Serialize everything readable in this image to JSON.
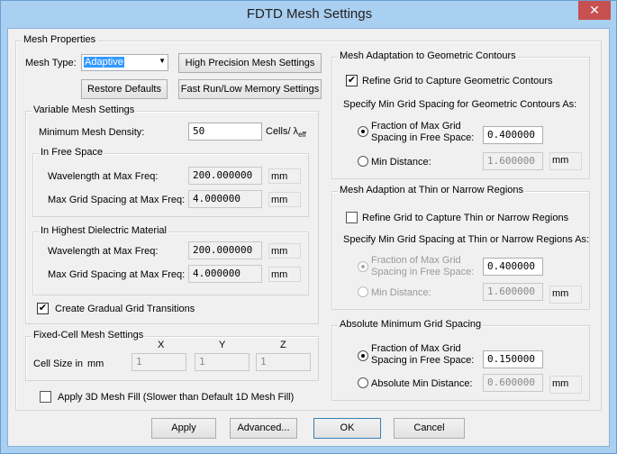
{
  "title": "FDTD Mesh Settings",
  "close": "✕",
  "mesh_properties": {
    "label": "Mesh Properties",
    "mesh_type_label": "Mesh Type:",
    "mesh_type_value": "Adaptive",
    "high_precision": "High Precision Mesh Settings",
    "restore_defaults": "Restore Defaults",
    "fast_run": "Fast Run/Low Memory Settings"
  },
  "variable": {
    "label": "Variable Mesh Settings",
    "min_density_label": "Minimum Mesh Density:",
    "min_density_value": "50",
    "min_density_unit": "Cells/ λ",
    "min_density_sub": "eff",
    "free_space": {
      "label": "In Free Space",
      "wavelength_label": "Wavelength at Max Freq:",
      "wavelength_value": "200.000000",
      "wavelength_unit": "mm",
      "spacing_label": "Max Grid Spacing at Max Freq:",
      "spacing_value": "4.000000",
      "spacing_unit": "mm"
    },
    "dielectric": {
      "label": "In Highest Dielectric Material",
      "wavelength_label": "Wavelength at Max Freq:",
      "wavelength_value": "200.000000",
      "wavelength_unit": "mm",
      "spacing_label": "Max Grid Spacing at Max Freq:",
      "spacing_value": "4.000000",
      "spacing_unit": "mm"
    },
    "gradual_label": "Create Gradual Grid Transitions",
    "gradual_checked": true
  },
  "fixed": {
    "label": "Fixed-Cell Mesh Settings",
    "x": "X",
    "y": "Y",
    "z": "Z",
    "cell_size_label": "Cell Size in",
    "unit": "mm",
    "x_value": "1",
    "y_value": "1",
    "z_value": "1"
  },
  "apply3d": {
    "label": "Apply 3D Mesh Fill (Slower than Default 1D Mesh Fill)",
    "checked": false
  },
  "contours": {
    "label": "Mesh Adaptation to Geometric Contours",
    "refine_label": "Refine Grid to Capture Geometric Contours",
    "refine_checked": true,
    "specify": "Specify Min Grid Spacing for Geometric Contours As:",
    "fraction_label1": "Fraction of Max Grid",
    "fraction_label2": "Spacing in Free Space:",
    "fraction_value": "0.400000",
    "min_label": "Min Distance:",
    "min_value": "1.600000",
    "unit": "mm"
  },
  "thin": {
    "label": "Mesh Adaption at Thin or Narrow Regions",
    "refine_label": "Refine Grid to Capture Thin or Narrow Regions",
    "refine_checked": false,
    "specify": "Specify Min Grid Spacing at Thin or Narrow Regions As:",
    "fraction_label1": "Fraction of Max Grid",
    "fraction_label2": "Spacing in Free Space:",
    "fraction_value": "0.400000",
    "min_label": "Min Distance:",
    "min_value": "1.600000",
    "unit": "mm"
  },
  "absolute": {
    "label": "Absolute Minimum Grid Spacing",
    "fraction_label1": "Fraction of Max Grid",
    "fraction_label2": "Spacing in Free Space:",
    "fraction_value": "0.150000",
    "min_label": "Absolute Min Distance:",
    "min_value": "0.600000",
    "unit": "mm"
  },
  "buttons": {
    "apply": "Apply",
    "advanced": "Advanced...",
    "ok": "OK",
    "cancel": "Cancel"
  }
}
